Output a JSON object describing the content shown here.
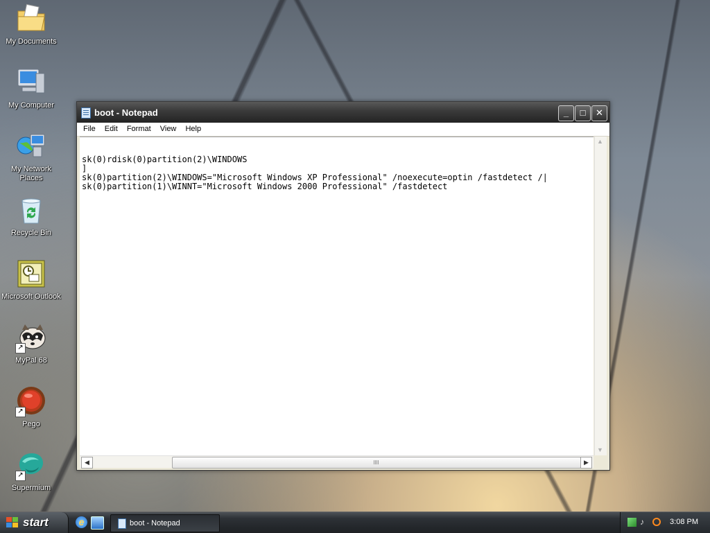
{
  "desktop": {
    "icons": [
      {
        "label": "My Documents",
        "icon": "folder-documents-icon"
      },
      {
        "label": "My Computer",
        "icon": "computer-icon"
      },
      {
        "label": "My Network Places",
        "icon": "network-places-icon"
      },
      {
        "label": "Recycle Bin",
        "icon": "recycle-bin-icon"
      },
      {
        "label": "Microsoft Outlook",
        "icon": "outlook-icon"
      },
      {
        "label": "MyPal 68",
        "icon": "mypal-icon"
      },
      {
        "label": "Pego",
        "icon": "pego-icon"
      },
      {
        "label": "Supermium",
        "icon": "supermium-icon"
      }
    ]
  },
  "window": {
    "title": "boot - Notepad",
    "menu": [
      "File",
      "Edit",
      "Format",
      "View",
      "Help"
    ],
    "content": "sk(0)rdisk(0)partition(2)\\WINDOWS\n]\nsk(0)partition(2)\\WINDOWS=\"Microsoft Windows XP Professional\" /noexecute=optin /fastdetect /|\nsk(0)partition(1)\\WINNT=\"Microsoft Windows 2000 Professional\" /fastdetect"
  },
  "taskbar": {
    "start_label": "start",
    "task_label": "boot - Notepad",
    "clock": "3:08 PM"
  },
  "colors": {
    "title_bar": "#3c3c3c",
    "taskbar": "#2d3136"
  }
}
